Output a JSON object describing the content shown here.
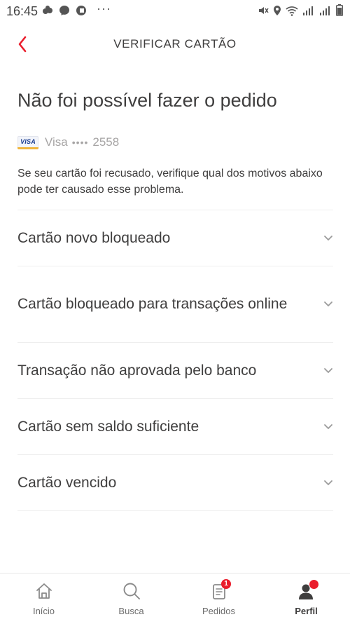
{
  "status_bar": {
    "time": "16:45",
    "more": "···"
  },
  "header": {
    "title": "VERIFICAR CARTÃO"
  },
  "main": {
    "title": "Não foi possível fazer o pedido",
    "card": {
      "logo_text": "VISA",
      "brand": "Visa",
      "mask": "••••",
      "last4": "2558"
    },
    "description": "Se seu cartão foi recusado, verifique qual dos motivos abaixo pode ter causado esse problema.",
    "reasons": [
      {
        "label": "Cartão novo bloqueado"
      },
      {
        "label": "Cartão bloqueado para transações online"
      },
      {
        "label": "Transação não aprovada pelo banco"
      },
      {
        "label": "Cartão sem saldo suficiente"
      },
      {
        "label": "Cartão vencido"
      }
    ]
  },
  "bottom_nav": {
    "items": [
      {
        "label": "Início",
        "icon": "home-icon"
      },
      {
        "label": "Busca",
        "icon": "search-icon"
      },
      {
        "label": "Pedidos",
        "icon": "orders-icon",
        "badge": "1"
      },
      {
        "label": "Perfil",
        "icon": "profile-icon",
        "active": true
      }
    ]
  },
  "colors": {
    "accent": "#ea1d2c",
    "text": "#3f3e3e",
    "muted": "#a6a4a4",
    "divider": "#eeeeee"
  }
}
